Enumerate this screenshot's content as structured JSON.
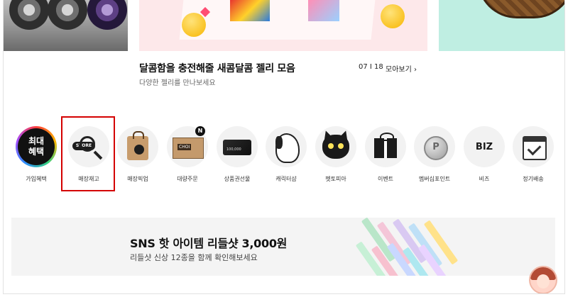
{
  "promo": {
    "title": "달콤함을 충전해줄 새콤달콤 젤리 모음",
    "subtitle": "다양한 젤리를 만나보세요",
    "counter": "07 I 18",
    "more_label": "모아보기 ›"
  },
  "categories": [
    {
      "label": "가입혜택",
      "badge_text": [
        "최대",
        "혜택"
      ],
      "icon": "benefit-ring-icon"
    },
    {
      "label": "매장재고",
      "icon_text": "STORE",
      "icon": "store-search-icon"
    },
    {
      "label": "매장픽업",
      "icon": "shopping-bag-icon"
    },
    {
      "label": "대량주문",
      "icon": "box-icon",
      "badge": "N",
      "box_text": "CHOI"
    },
    {
      "label": "상품권선물",
      "icon": "gift-card-icon",
      "card_text": "100,000"
    },
    {
      "label": "캐릭터샵",
      "icon": "snoopy-icon"
    },
    {
      "label": "펫토피아",
      "icon": "black-cat-icon"
    },
    {
      "label": "이벤트",
      "icon": "gift-box-icon"
    },
    {
      "label": "멤버십포인트",
      "icon": "point-coin-icon",
      "coin_text": "P"
    },
    {
      "label": "비즈",
      "icon": "biz-icon",
      "icon_text": "BIZ"
    },
    {
      "label": "정기배송",
      "icon": "calendar-check-icon"
    }
  ],
  "banner": {
    "title": "SNS 핫 아이템 리들샷 3,000원",
    "subtitle": "리들샷 신상 12종을 함께 확인해보세요"
  },
  "colors": {
    "highlight": "#d40000",
    "text": "#111111",
    "muted": "#666666",
    "banner_bg": "#f4f4f4",
    "stick_colors": [
      "#b9e6c9",
      "#f4c6d8",
      "#d9c9f2",
      "#bfe0f7",
      "#ffe28a",
      "#c7f0d6",
      "#f7c1cf",
      "#c9d8ff",
      "#aee8f0",
      "#e9d3ff"
    ]
  }
}
